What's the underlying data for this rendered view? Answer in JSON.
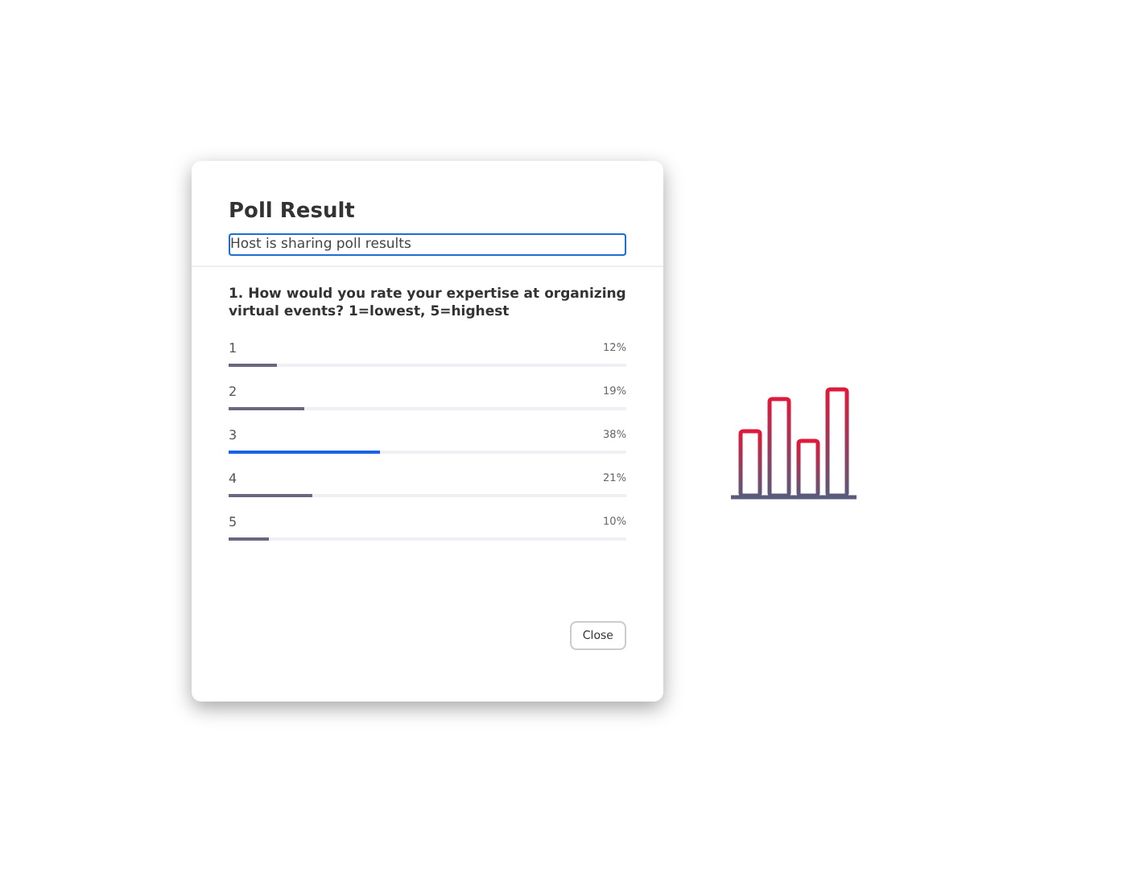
{
  "dialog": {
    "title": "Poll Result",
    "status": "Host is sharing poll results",
    "question": "1. How would you rate your expertise at organizing virtual events? 1=lowest, 5=highest",
    "options": [
      {
        "label": "1",
        "percent": "12%",
        "level": 0.12,
        "selected": false
      },
      {
        "label": "2",
        "percent": "19%",
        "level": 0.19,
        "selected": false
      },
      {
        "label": "3",
        "percent": "38%",
        "level": 0.38,
        "selected": true
      },
      {
        "label": "4",
        "percent": "21%",
        "level": 0.21,
        "selected": false
      },
      {
        "label": "5",
        "percent": "10%",
        "level": 0.1,
        "selected": false
      }
    ],
    "close_button": "Close"
  }
}
